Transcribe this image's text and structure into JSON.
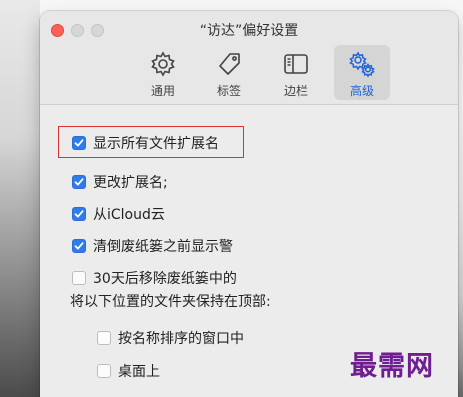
{
  "window": {
    "title": "“访达”偏好设置"
  },
  "tabs": [
    {
      "label": "通用",
      "icon": "gear-icon",
      "active": false
    },
    {
      "label": "标签",
      "icon": "tag-icon",
      "active": false
    },
    {
      "label": "边栏",
      "icon": "sidebar-icon",
      "active": false
    },
    {
      "label": "高级",
      "icon": "gears-icon",
      "active": true
    }
  ],
  "options": [
    {
      "label": "显示所有文件扩展名",
      "checked": true
    },
    {
      "label": "更改扩展名;",
      "checked": true
    },
    {
      "label": "从iCloud云",
      "checked": true
    },
    {
      "label": "清倒废纸篓之前显示警",
      "checked": true
    },
    {
      "label": "30天后移除废纸篓中的",
      "checked": false
    }
  ],
  "folders_section": {
    "title": "将以下位置的文件夹保持在顶部:",
    "options": [
      {
        "label": "按名称排序的窗口中",
        "checked": false
      },
      {
        "label": "桌面上",
        "checked": false
      }
    ]
  },
  "watermark": "最需网",
  "colors": {
    "accent": "#2f7be8",
    "highlight_box": "#e0312e",
    "watermark": "#6e1e90",
    "close_button": "#fe5f57"
  }
}
